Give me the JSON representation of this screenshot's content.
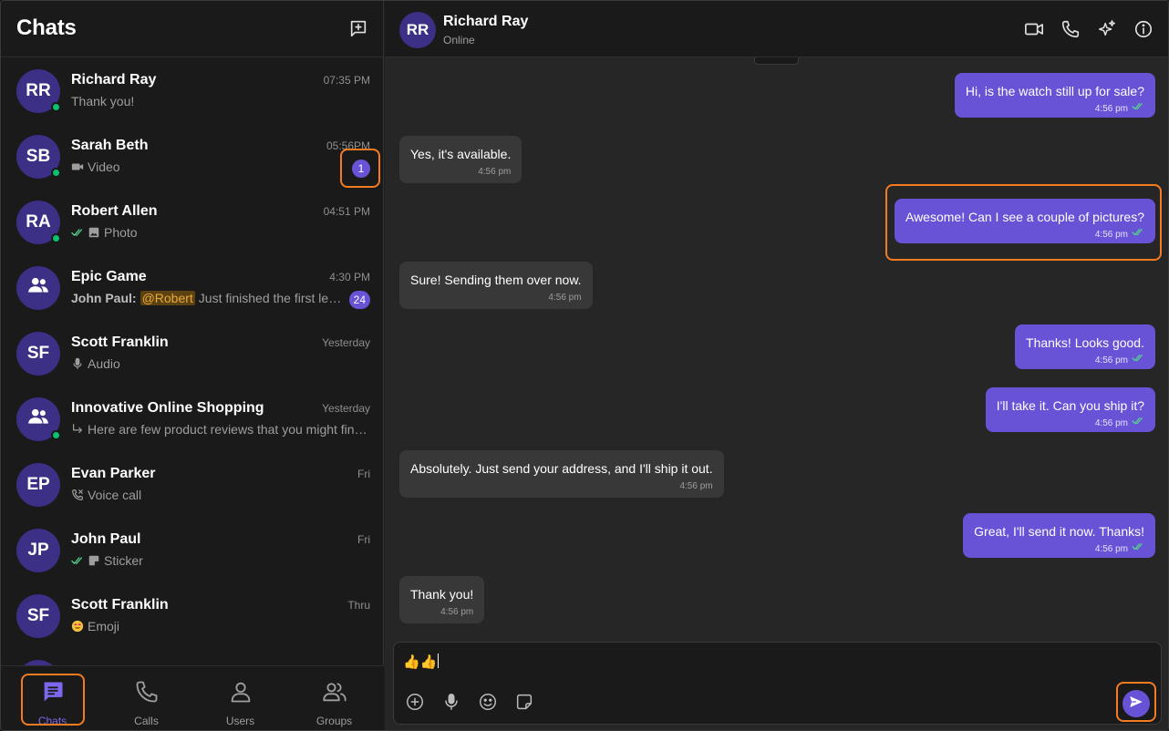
{
  "sidebar": {
    "title": "Chats",
    "chats": [
      {
        "initials": "RR",
        "name": "Richard Ray",
        "time": "07:35 PM",
        "preview": "Thank you!",
        "online": true,
        "preview_icon": "",
        "badge": ""
      },
      {
        "initials": "SB",
        "name": "Sarah Beth",
        "time": "05:56PM",
        "preview": "Video",
        "online": true,
        "preview_icon": "video-icon",
        "badge": "1"
      },
      {
        "initials": "RA",
        "name": "Robert Allen",
        "time": "04:51 PM",
        "preview": "Photo",
        "online": true,
        "preview_icon": "photo-icon",
        "badge": ""
      },
      {
        "initials": "",
        "name": "Epic Game",
        "time": "4:30 PM",
        "sender": "John Paul:",
        "mention": "@Robert",
        "preview": "Just finished the first level",
        "online": false,
        "preview_icon": "group-icon",
        "badge": "24"
      },
      {
        "initials": "SF",
        "name": "Scott Franklin",
        "time": "Yesterday",
        "preview": "Audio",
        "online": false,
        "preview_icon": "mic-icon",
        "badge": ""
      },
      {
        "initials": "",
        "name": "Innovative Online Shopping",
        "time": "Yesterday",
        "preview": "Here are few product reviews that you might find useful",
        "online": true,
        "preview_icon": "reply-icon",
        "badge": ""
      },
      {
        "initials": "EP",
        "name": "Evan Parker",
        "time": "Fri",
        "preview": "Voice call",
        "online": false,
        "preview_icon": "call-icon",
        "badge": ""
      },
      {
        "initials": "JP",
        "name": "John Paul",
        "time": "Fri",
        "preview": "Sticker",
        "online": false,
        "preview_icon": "sticker-icon",
        "badge": ""
      },
      {
        "initials": "SF",
        "name": "Scott Franklin",
        "time": "Thru",
        "preview": "Emoji",
        "online": false,
        "preview_icon": "emoji-icon",
        "badge": ""
      }
    ]
  },
  "nav": {
    "chats": "Chats",
    "calls": "Calls",
    "users": "Users",
    "groups": "Groups"
  },
  "conversation": {
    "contact_initials": "RR",
    "contact_name": "Richard Ray",
    "contact_status": "Online",
    "messages": [
      {
        "dir": "out",
        "text": "Hi, is the watch still up for sale?",
        "time": "4:56 pm"
      },
      {
        "dir": "in",
        "text": "Yes, it's available.",
        "time": "4:56 pm"
      },
      {
        "dir": "out",
        "text": "Awesome! Can I see a couple of pictures?",
        "time": "4:56 pm"
      },
      {
        "dir": "in",
        "text": "Sure! Sending them over now.",
        "time": "4:56 pm"
      },
      {
        "dir": "out",
        "text": "Thanks! Looks good.",
        "time": "4:56 pm"
      },
      {
        "dir": "out",
        "text": "I'll take it. Can you ship it?",
        "time": "4:56 pm"
      },
      {
        "dir": "in",
        "text": "Absolutely. Just send your address, and I'll ship it out.",
        "time": "4:56 pm"
      },
      {
        "dir": "out",
        "text": "Great, I'll send it now. Thanks!",
        "time": "4:56 pm"
      },
      {
        "dir": "in",
        "text": "Thank you!",
        "time": "4:56 pm"
      }
    ]
  },
  "composer": {
    "value": "👍👍"
  },
  "colors": {
    "accent": "#6852d6",
    "avatar": "#3b2f86",
    "online": "#09c26f",
    "highlight": "#f47b20",
    "read_tick": "#54d38c"
  }
}
